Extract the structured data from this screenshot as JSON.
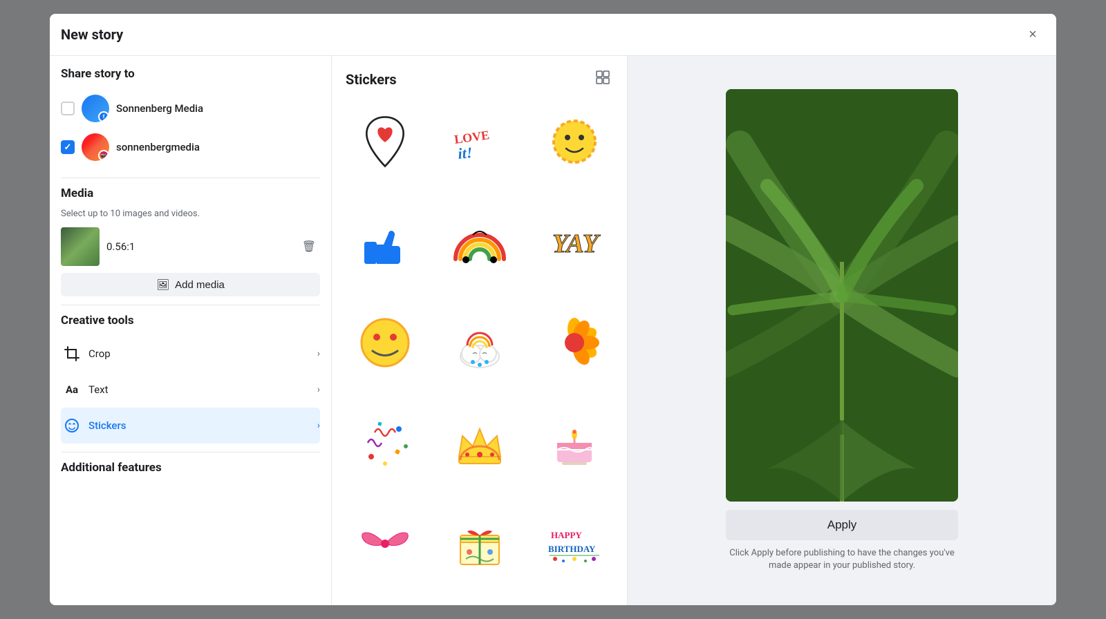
{
  "modal": {
    "title": "New story",
    "close_label": "×"
  },
  "left_panel": {
    "share_section_title": "Share story to",
    "accounts": [
      {
        "id": "fb",
        "name": "Sonnenberg Media",
        "checked": false,
        "badge": "fb"
      },
      {
        "id": "ig",
        "name": "sonnenbergmedia",
        "checked": true,
        "badge": "ig"
      }
    ],
    "media_section_title": "Media",
    "media_subtitle": "Select up to 10 images and videos.",
    "media_items": [
      {
        "ratio": "0.56:1"
      }
    ],
    "add_media_label": "Add media",
    "creative_tools_title": "Creative tools",
    "tools": [
      {
        "id": "crop",
        "label": "Crop",
        "active": false
      },
      {
        "id": "text",
        "label": "Text",
        "active": false
      },
      {
        "id": "stickers",
        "label": "Stickers",
        "active": true
      }
    ],
    "additional_features_title": "Additional features"
  },
  "middle_panel": {
    "title": "Stickers",
    "grid_icon": "⊞"
  },
  "right_panel": {
    "apply_label": "Apply",
    "apply_hint": "Click Apply before publishing to have the changes you've made appear in your published story."
  },
  "icons": {
    "close": "✕",
    "crop": "⊡",
    "text": "Aa",
    "stickers": "★",
    "add_media": "🖼",
    "delete": "🗑",
    "chevron_right": "›",
    "grid": "⊞"
  }
}
